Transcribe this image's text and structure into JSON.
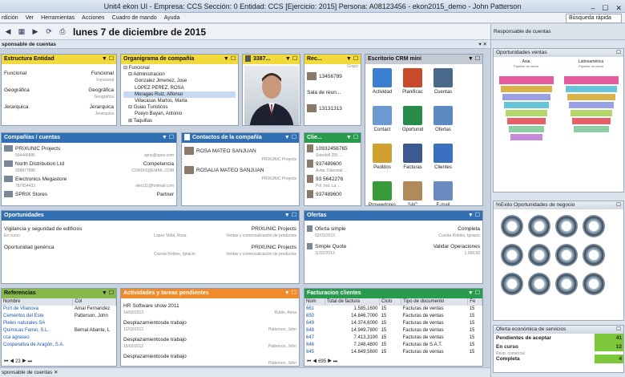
{
  "window": {
    "title": "Unit4 ekon UI - Empresa: CCS Sección: 0 Entidad: CCS [Ejercicio: 2015] Persona: A08123456 - ekon2015_demo - John Patterson"
  },
  "menu": [
    "rdición",
    "Ver",
    "Herramientas",
    "Acciones",
    "Cuadro de mando",
    "Ayuda"
  ],
  "quick_search": "Búsqueda rápida",
  "toolbar": {
    "date": "lunes 7 de diciembre de 2015"
  },
  "left_sub": "sponsable de cuentas",
  "right_sub": "Responsable de cuentas",
  "estructura": {
    "title": "Estructura Entidad",
    "rows": [
      {
        "l": "Funcional",
        "r": "Funcional",
        "s": "Funcional"
      },
      {
        "l": "Geográfica",
        "r": "Geográfica",
        "s": "Geográfica"
      },
      {
        "l": "Jerarquica",
        "r": "Jerarquica",
        "s": "Jerarquica"
      }
    ]
  },
  "organigrama": {
    "title": "Organigrama de compañía",
    "items": [
      "Funcional",
      "Administracion",
      "Gonzalez Jimenez, Jose",
      "LOPEZ PEREZ, ROSA",
      "Moragas Ruiz, Alfonso",
      "Villacasas Martos, Marta",
      "Guias Turisticos",
      "Pueyo Bayan, Antonio",
      "Taquillas"
    ]
  },
  "person": {
    "title": "3387..."
  },
  "recent": {
    "title": "Rec...",
    "sub": "Grupo",
    "rows": [
      "13456789",
      "Sala de reun...",
      "13131313"
    ]
  },
  "crm": {
    "title": "Escritorio CRM mini",
    "items": [
      {
        "label": "Actividad",
        "color": "#3a7fd0"
      },
      {
        "label": "Planificac",
        "color": "#c84a2a"
      },
      {
        "label": "Cuentas",
        "color": "#4a6a8a"
      },
      {
        "label": "Contact",
        "color": "#6a9ad0"
      },
      {
        "label": "Oportunid",
        "color": "#2a8a4a"
      },
      {
        "label": "Ofertas",
        "color": "#5a8ac0"
      },
      {
        "label": "Pedidos",
        "color": "#d0a030"
      },
      {
        "label": "Facturas",
        "color": "#3a5a90"
      },
      {
        "label": "Clientes",
        "color": "#3a70c0"
      },
      {
        "label": "Proveedores",
        "color": "#3a9a3a"
      },
      {
        "label": "SAC",
        "color": "#b08a5a"
      },
      {
        "label": "E-mail",
        "color": "#6a8ac0"
      },
      {
        "label": "Informes",
        "color": "#4a7ab0"
      },
      {
        "label": "Calculadora",
        "color": "#8a8a8a"
      },
      {
        "label": "Servicios",
        "color": "#5a5a6a"
      }
    ]
  },
  "companias": {
    "title": "Compañías / cuentas",
    "rows": [
      {
        "l": "PRIXUNIC Projects",
        "s": "564446885",
        "r": "",
        "rs": "spris@spris.com"
      },
      {
        "l": "North Distribution Ltd",
        "s": "938877886",
        "r": "Competencia",
        "rs": "CONDIS@EMAIL.COM"
      },
      {
        "l": "Electronics Megastore",
        "s": "787654433",
        "r": "",
        "rs": "elect11@hotmail.com"
      },
      {
        "l": "SPRIX Stores",
        "s": "",
        "r": "Partner",
        "rs": ""
      }
    ]
  },
  "contactos": {
    "title": "Contactos de la compañía",
    "rows": [
      {
        "l": "ROSA MATEO SANJUAN",
        "s": "PRIXUNIC Projects"
      },
      {
        "l": "ROSALIA MATEO SANJUAN",
        "s": "PRIXUNIC Projects"
      }
    ]
  },
  "clientes": {
    "title": "Clie...",
    "rows": [
      {
        "l": "10932456765",
        "s": "Sotedell 255 ..."
      },
      {
        "l": "937489600",
        "s": "Avda. Diaconal ..."
      },
      {
        "l": "93 5642276",
        "s": "Pol. Ind. La ..."
      },
      {
        "l": "937489600",
        "s": ""
      }
    ]
  },
  "oportunidades": {
    "title": "Oportunidades",
    "rows": [
      {
        "l": "Vigilancia y seguridad de edificios",
        "r": "PRIXUNIC Projects",
        "s1": "En curso",
        "s2": "Lopez Vidal, Rosa",
        "s3": "Ventas y comercialización de productos"
      },
      {
        "l": "Oportunidad genérica",
        "r": "PRIXUNIC Projects",
        "s1": "",
        "s2": "Cuesta Robles, Ignacio",
        "s3": "Ventas y comercialización de productos"
      }
    ]
  },
  "ofertas": {
    "title": "Ofertas",
    "rows": [
      {
        "l": "Oferta simple",
        "r": "Completa",
        "s": "02/01/2013",
        "rs": "Cuesta Robles, Ignacio"
      },
      {
        "l": "Simple Quote",
        "r": "Validar Operaciones",
        "s": "11/02/2013",
        "rs": "1.068,50"
      }
    ]
  },
  "referencias": {
    "title": "Referencias",
    "cols": [
      "Nombre",
      "Col"
    ],
    "rows": [
      [
        "Port de Vilanova",
        "Arnal Fernandez"
      ],
      [
        "Cementos del Este",
        "Patterson, John"
      ],
      [
        "Pieles naturales SA",
        ""
      ],
      [
        "Químicas Ferrer, S.L.",
        "Bernal Abante, L"
      ],
      [
        "cca agraseo",
        ""
      ],
      [
        "Cooperativa de Aragón, S.A.",
        ""
      ]
    ],
    "pager": "23"
  },
  "actividades": {
    "title": "Actividades y tareas pendientes",
    "rows": [
      {
        "l": "HR Software show 2011",
        "s": "14/03/2013",
        "rs": "Rubio, Anna"
      },
      {
        "l": "Desplazamientosde trabajo",
        "s": "12/03/2012",
        "rs": "Patterson, John"
      },
      {
        "l": "Desplazamientosde trabajo",
        "s": "15/03/2012",
        "rs": "Patterson, John"
      },
      {
        "l": "Desplazamientosde trabajo",
        "s": "",
        "rs": "Patterson, John"
      }
    ]
  },
  "facturacion": {
    "title": "Facturacion clientes",
    "cols": [
      "Núm",
      "Total de factura",
      "Ciclo",
      "Tipo de documento",
      "Fe"
    ],
    "rows": [
      [
        "661",
        "1.585,1600",
        "15",
        "Facturas de ventas",
        "15"
      ],
      [
        "650",
        "14.846,7000",
        "15",
        "Facturas de ventas",
        "15"
      ],
      [
        "649",
        "14.374,6000",
        "15",
        "Facturas de ventas",
        "15"
      ],
      [
        "648",
        "14.949,7800",
        "15",
        "Facturas de ventas",
        "15"
      ],
      [
        "647",
        "7.413,3100",
        "15",
        "Facturas de ventas",
        "15"
      ],
      [
        "646",
        "7.248,4800",
        "15",
        "Facturas de S.A.T.",
        "15"
      ],
      [
        "645",
        "14.849,5600",
        "15",
        "Facturas de ventas",
        "15"
      ]
    ],
    "pager": "695"
  },
  "rp1": {
    "title": "Oportunidades ventas",
    "left_title": "Asia",
    "left_sub": "Pipeline de venta",
    "right_title": "Latinoamérica",
    "right_sub": "Pipeline de venta"
  },
  "rp2": {
    "title": "%Exito Oportunidades de negocio"
  },
  "rp3": {
    "title": "Oferta económica de servicios",
    "rows": [
      {
        "l": "Pendientes de aceptar",
        "v": "41"
      },
      {
        "l": "En curso",
        "s": "Resp. comercial",
        "v": "12"
      },
      {
        "l": "Completa",
        "v": "4"
      }
    ]
  },
  "bottom": "sponsable de cuentas"
}
